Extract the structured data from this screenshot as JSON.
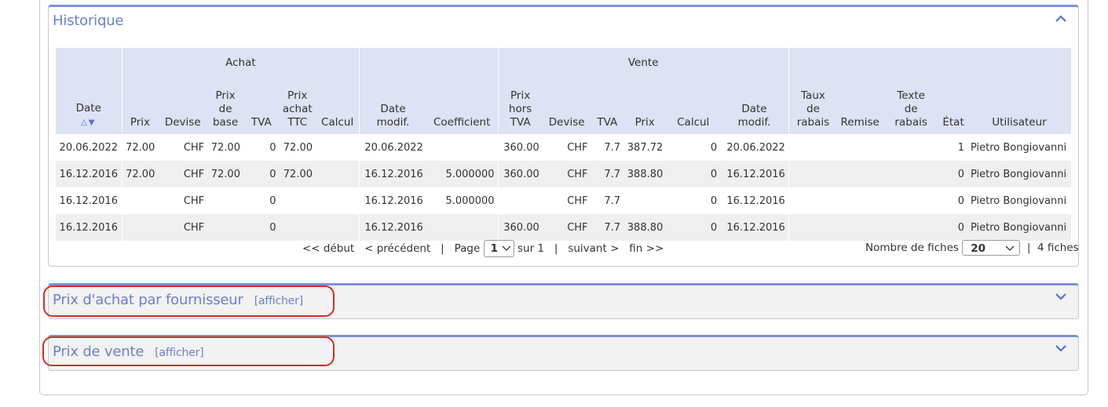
{
  "historique": {
    "title": "Historique",
    "group_headers": {
      "achat": "Achat",
      "vente": "Vente"
    },
    "columns": [
      [
        "Date"
      ],
      [
        "Prix"
      ],
      [
        "Devise"
      ],
      [
        "Prix",
        "de",
        "base"
      ],
      [
        "TVA"
      ],
      [
        "Prix",
        "achat",
        "TTC"
      ],
      [
        "Calcul"
      ],
      [
        "Date",
        "modif."
      ],
      [
        "Coefficient"
      ],
      [
        "Prix",
        "hors",
        "TVA"
      ],
      [
        "Devise"
      ],
      [
        "TVA"
      ],
      [
        "Prix"
      ],
      [
        "Calcul"
      ],
      [
        "Date",
        "modif."
      ],
      [
        "Taux",
        "de",
        "rabais"
      ],
      [
        "Remise"
      ],
      [
        "Texte",
        "de",
        "rabais"
      ],
      [
        "État"
      ],
      [
        "Utilisateur"
      ]
    ],
    "sort_icons": "△▼",
    "rows": [
      [
        "20.06.2022",
        "72.00",
        "CHF",
        "72.00",
        "0",
        "72.00",
        "",
        "20.06.2022",
        "",
        "360.00",
        "CHF",
        "7.7",
        "387.72",
        "0",
        "20.06.2022",
        "",
        "",
        "",
        "1",
        "Pietro Bongiovanni"
      ],
      [
        "16.12.2016",
        "72.00",
        "CHF",
        "72.00",
        "0",
        "72.00",
        "",
        "16.12.2016",
        "5.000000",
        "360.00",
        "CHF",
        "7.7",
        "388.80",
        "0",
        "16.12.2016",
        "",
        "",
        "",
        "0",
        "Pietro Bongiovanni"
      ],
      [
        "16.12.2016",
        "",
        "CHF",
        "",
        "0",
        "",
        "",
        "16.12.2016",
        "5.000000",
        "",
        "CHF",
        "7.7",
        "",
        "0",
        "16.12.2016",
        "",
        "",
        "",
        "0",
        "Pietro Bongiovanni"
      ],
      [
        "16.12.2016",
        "",
        "CHF",
        "",
        "0",
        "",
        "",
        "16.12.2016",
        "",
        "360.00",
        "CHF",
        "7.7",
        "388.80",
        "0",
        "16.12.2016",
        "",
        "",
        "",
        "0",
        "Pietro Bongiovanni"
      ]
    ],
    "pager": {
      "first": "<< début",
      "prev": "< précédent",
      "sep": "|",
      "page_label": "Page",
      "page_value": "1",
      "of": "sur 1",
      "next": "suivant >",
      "last": "fin >>"
    },
    "records": {
      "label": "Nombre de fiches",
      "value": "20",
      "count": "4 fiches"
    }
  },
  "panel_fournisseur": {
    "title": "Prix d'achat par fournisseur",
    "toggle": "[afficher]"
  },
  "panel_vente": {
    "title": "Prix de vente",
    "toggle": "[afficher]"
  },
  "colors": {
    "accent": "#6b7fd0",
    "header_bg": "#dde2f4",
    "highlight": "#d62b2b"
  },
  "icons": {
    "collapse": "chevron-up-icon",
    "expand": "chevron-down-icon",
    "select": "chevron-down-icon"
  }
}
